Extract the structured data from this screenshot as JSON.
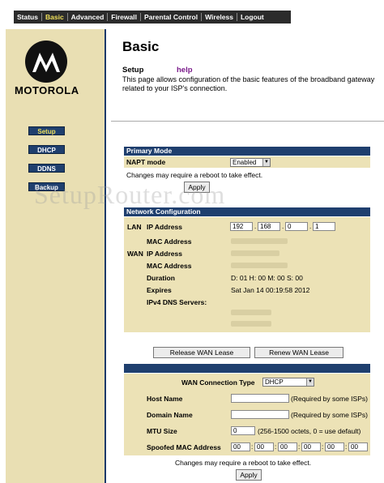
{
  "nav": {
    "items": [
      "Status",
      "Basic",
      "Advanced",
      "Firewall",
      "Parental Control",
      "Wireless",
      "Logout"
    ],
    "active": "Basic"
  },
  "sidebar": {
    "logo_text": "MOTOROLA",
    "buttons": [
      "Setup",
      "DHCP",
      "DDNS",
      "Backup"
    ]
  },
  "header": {
    "title": "Basic",
    "setup": "Setup",
    "help": "help",
    "description": "This page allows configuration of the basic features of the broadband gateway related to your ISP's connection."
  },
  "watermark": "SetupRouter.com",
  "primary_mode": {
    "title": "Primary Mode",
    "napt_label": "NAPT mode",
    "napt_value": "Enabled",
    "note": "Changes may require a reboot to take effect.",
    "apply": "Apply"
  },
  "network_config": {
    "title": "Network Configuration",
    "lan": "LAN",
    "wan": "WAN",
    "ip_address": "IP Address",
    "mac_address": "MAC Address",
    "lan_ip": [
      "192",
      "168",
      "0",
      "1"
    ],
    "duration_label": "Duration",
    "duration_value": "D: 01 H: 00 M: 00 S: 00",
    "expires_label": "Expires",
    "expires_value": "Sat Jan 14 00:19:58 2012",
    "dns_label": "IPv4 DNS Servers:"
  },
  "wan_buttons": {
    "release": "Release WAN Lease",
    "renew": "Renew WAN Lease"
  },
  "wan_connection": {
    "type_label": "WAN Connection Type",
    "type_value": "DHCP",
    "host_name_label": "Host Name",
    "host_name_value": "",
    "host_name_hint": "(Required by some ISPs)",
    "domain_name_label": "Domain Name",
    "domain_name_value": "",
    "domain_name_hint": "(Required by some ISPs)",
    "mtu_label": "MTU Size",
    "mtu_value": "0",
    "mtu_hint": "(256-1500 octets, 0 = use default)",
    "spoofed_mac_label": "Spoofed MAC Address",
    "spoofed_mac": [
      "00",
      "00",
      "00",
      "00",
      "00",
      "00"
    ],
    "note": "Changes may require a reboot to take effect.",
    "apply": "Apply"
  }
}
